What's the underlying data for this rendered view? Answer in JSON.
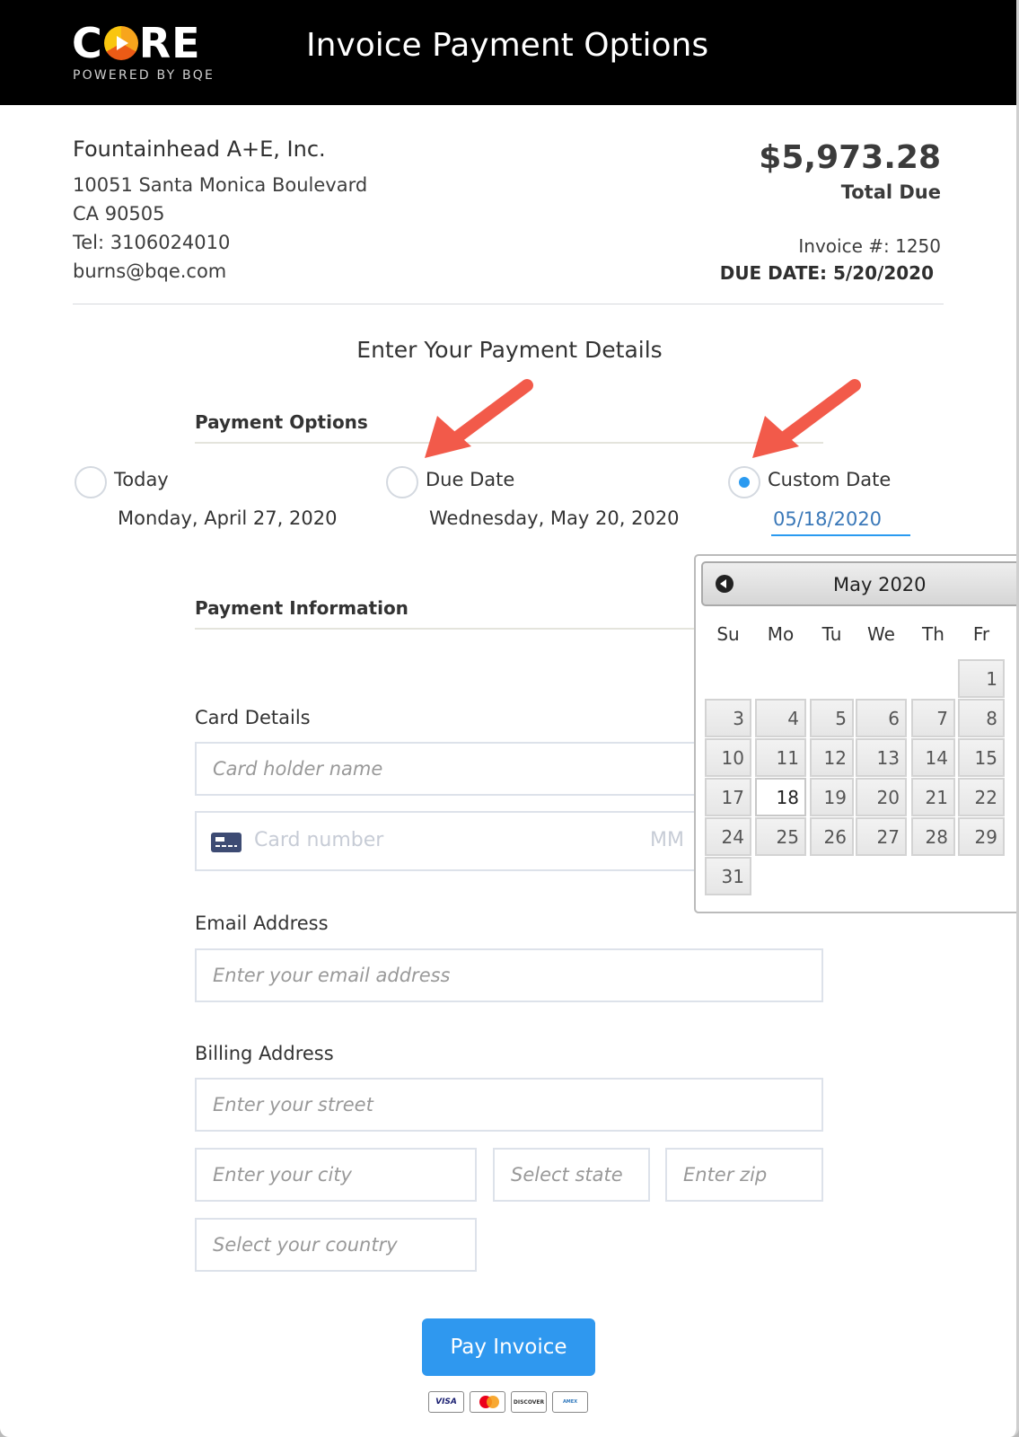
{
  "header": {
    "logo_main": "CORE",
    "logo_sub": "POWERED BY BQE",
    "title": "Invoice Payment Options"
  },
  "company": {
    "name": "Fountainhead A+E, Inc.",
    "address_line1": "10051 Santa Monica Boulevard",
    "address_line2": "CA 90505",
    "tel": "Tel: 3106024010",
    "email": "burns@bqe.com"
  },
  "invoice": {
    "amount": "$5,973.28",
    "total_due_label": "Total Due",
    "invoice_number": "Invoice #: 1250",
    "due_date": "DUE DATE: 5/20/2020"
  },
  "form": {
    "title": "Enter Your Payment Details",
    "payment_options_heading": "Payment Options",
    "options": [
      {
        "label": "Today",
        "sub": "Monday, April 27, 2020",
        "checked": false
      },
      {
        "label": "Due Date",
        "sub": "Wednesday, May 20, 2020",
        "checked": false
      },
      {
        "label": "Custom Date",
        "value": "05/18/2020",
        "checked": true
      }
    ],
    "payment_info_heading": "Payment Information",
    "card_details_label": "Card Details",
    "card_holder_placeholder": "Card holder name",
    "card_number_placeholder": "Card number",
    "card_expiry_placeholder": "MM",
    "email_label": "Email Address",
    "email_placeholder": "Enter your email address",
    "billing_label": "Billing Address",
    "street_placeholder": "Enter your street",
    "city_placeholder": "Enter your city",
    "state_placeholder": "Select state",
    "zip_placeholder": "Enter zip",
    "country_placeholder": "Select your country",
    "pay_button": "Pay Invoice",
    "card_brands": [
      "VISA",
      "MasterCard",
      "DISCOVER",
      "AMERICAN EXPRESS"
    ]
  },
  "datepicker": {
    "month_label": "May 2020",
    "weekdays": [
      "Su",
      "Mo",
      "Tu",
      "We",
      "Th",
      "Fr"
    ],
    "selected_day": 18,
    "weeks": [
      [
        null,
        null,
        null,
        null,
        null,
        1
      ],
      [
        3,
        4,
        5,
        6,
        7,
        8
      ],
      [
        10,
        11,
        12,
        13,
        14,
        15
      ],
      [
        17,
        18,
        19,
        20,
        21,
        22
      ],
      [
        24,
        25,
        26,
        27,
        28,
        29
      ],
      [
        31,
        null,
        null,
        null,
        null,
        null
      ]
    ]
  },
  "annotations": {
    "arrow_color": "#f25a4a"
  }
}
